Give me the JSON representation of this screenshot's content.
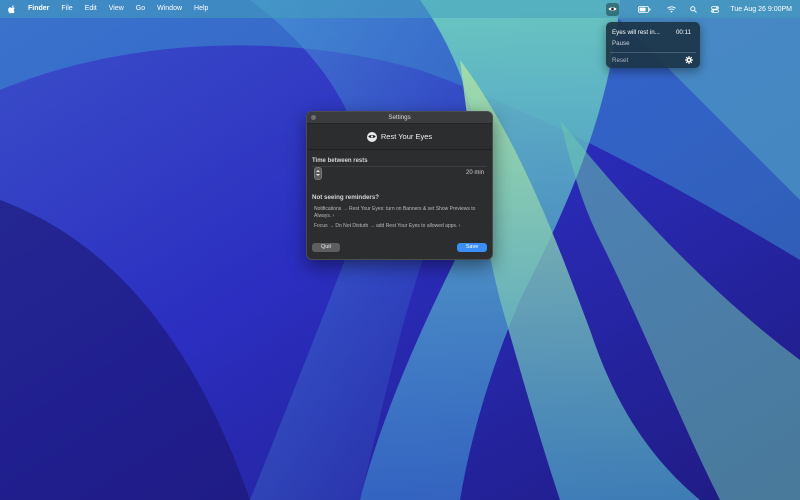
{
  "menubar": {
    "app_name": "Finder",
    "menus": [
      "File",
      "Edit",
      "View",
      "Go",
      "Window",
      "Help"
    ],
    "clock": "Tue Aug 26  9:00PM"
  },
  "status_menu": {
    "title": "Eyes will rest in...",
    "countdown": "00:11",
    "pause_label": "Pause",
    "reset_label": "Reset"
  },
  "settings_window": {
    "title": "Settings",
    "app_name": "Rest Your Eyes",
    "interval_label": "Time between rests",
    "interval_value": "20 min",
    "help_title": "Not seeing reminders?",
    "help_notifications": "Notifications → Rest Your Eyes: turn on Banners & set Show Previews to Always. ›",
    "help_focus": "Focus → Do Not Disturb → add Rest Your Eyes to allowed apps. ›",
    "quit_label": "Quit",
    "save_label": "Save"
  },
  "colors": {
    "accent_blue": "#3a8ef5",
    "window_bg": "#2b2d2f",
    "menu_bg": "#1c3446"
  },
  "icons": [
    "apple-icon",
    "eye-icon",
    "battery-icon",
    "wifi-icon",
    "search-icon",
    "control-center-icon",
    "gear-icon"
  ]
}
